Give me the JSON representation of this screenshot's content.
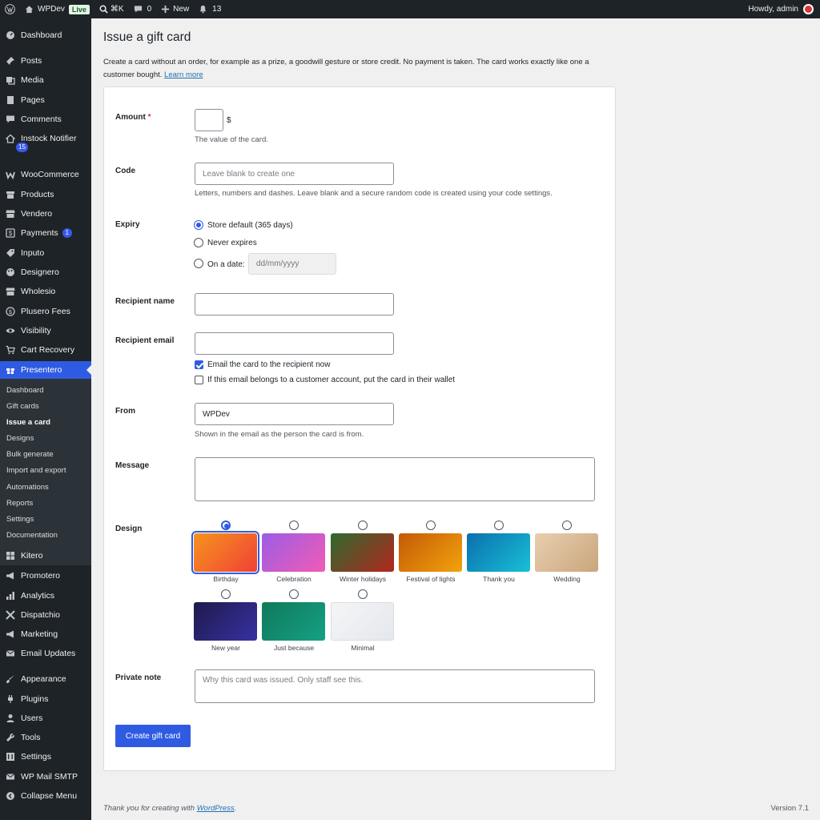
{
  "adminbar": {
    "site_name": "WPDev",
    "live_badge": "Live",
    "search_shortcut": "⌘K",
    "comments_count": "0",
    "new_label": "New",
    "notifications_count": "13",
    "greeting": "Howdy, admin"
  },
  "sidebar": {
    "items": [
      {
        "label": "Dashboard",
        "icon": "dashboard-icon"
      },
      {
        "label": "Posts",
        "icon": "pin-icon"
      },
      {
        "label": "Media",
        "icon": "media-icon"
      },
      {
        "label": "Pages",
        "icon": "pages-icon"
      },
      {
        "label": "Comments",
        "icon": "comment-icon"
      },
      {
        "label": "Instock Notifier",
        "icon": "bell-icon",
        "badge": "15"
      },
      {
        "label": "WooCommerce",
        "icon": "woo-icon"
      },
      {
        "label": "Products",
        "icon": "box-icon"
      },
      {
        "label": "Vendero",
        "icon": "store-icon"
      },
      {
        "label": "Payments",
        "icon": "dollar-icon",
        "badge": "1"
      },
      {
        "label": "Inputo",
        "icon": "tag-icon"
      },
      {
        "label": "Designero",
        "icon": "palette-icon"
      },
      {
        "label": "Wholesio",
        "icon": "store-icon"
      },
      {
        "label": "Plusero Fees",
        "icon": "coin-icon"
      },
      {
        "label": "Visibility",
        "icon": "eye-icon"
      },
      {
        "label": "Cart Recovery",
        "icon": "cart-icon"
      },
      {
        "label": "Presentero",
        "icon": "gift-icon"
      },
      {
        "label": "Kitero",
        "icon": "grid-icon"
      },
      {
        "label": "Promotero",
        "icon": "megaphone-icon"
      },
      {
        "label": "Analytics",
        "icon": "bar-chart-icon"
      },
      {
        "label": "Dispatchio",
        "icon": "plane-icon"
      },
      {
        "label": "Marketing",
        "icon": "megaphone-icon"
      },
      {
        "label": "Email Updates",
        "icon": "mail-icon"
      },
      {
        "label": "Appearance",
        "icon": "brush-icon"
      },
      {
        "label": "Plugins",
        "icon": "plug-icon"
      },
      {
        "label": "Users",
        "icon": "user-icon"
      },
      {
        "label": "Tools",
        "icon": "wrench-icon"
      },
      {
        "label": "Settings",
        "icon": "settings-icon"
      },
      {
        "label": "WP Mail SMTP",
        "icon": "mail-icon"
      },
      {
        "label": "Collapse Menu",
        "icon": "collapse-icon"
      }
    ],
    "submenu": [
      "Dashboard",
      "Gift cards",
      "Issue a card",
      "Designs",
      "Bulk generate",
      "Import and export",
      "Automations",
      "Reports",
      "Settings",
      "Documentation"
    ]
  },
  "page": {
    "title": "Issue a gift card",
    "intro": "Create a card without an order, for example as a prize, a goodwill gesture or store credit. No payment is taken. The card works exactly like one a customer bought.",
    "learn_more": "Learn more"
  },
  "form": {
    "amount": {
      "label": "Amount",
      "required_mark": "*",
      "currency": "$",
      "value": "",
      "help": "The value of the card."
    },
    "code": {
      "label": "Code",
      "placeholder": "Leave blank to create one",
      "help": "Letters, numbers and dashes. Leave blank and a secure random code is created using your code settings."
    },
    "expiry": {
      "label": "Expiry",
      "options": [
        "Store default (365 days)",
        "Never expires",
        "On a date:"
      ],
      "selected": "Store default (365 days)",
      "date_placeholder": "dd/mm/yyyy"
    },
    "recipient_name": {
      "label": "Recipient name",
      "value": ""
    },
    "recipient_email": {
      "label": "Recipient email",
      "value": "",
      "email_now": "Email the card to the recipient now",
      "email_now_checked": true,
      "wallet": "If this email belongs to a customer account, put the card in their wallet",
      "wallet_checked": false
    },
    "from": {
      "label": "From",
      "value": "WPDev",
      "help": "Shown in the email as the person the card is from."
    },
    "message": {
      "label": "Message",
      "value": ""
    },
    "design": {
      "label": "Design",
      "selected": "Birthday",
      "options": [
        {
          "name": "Birthday",
          "colors": [
            "#f7941d",
            "#ef4136"
          ]
        },
        {
          "name": "Celebration",
          "colors": [
            "#9b5de5",
            "#f15bb5"
          ]
        },
        {
          "name": "Winter holidays",
          "colors": [
            "#2d6a2e",
            "#b3261e"
          ]
        },
        {
          "name": "Festival of lights",
          "colors": [
            "#c45a06",
            "#f2a20c"
          ]
        },
        {
          "name": "Thank you",
          "colors": [
            "#0b6fae",
            "#19c0d6"
          ]
        },
        {
          "name": "Wedding",
          "colors": [
            "#e8cfb0",
            "#c9a57c"
          ]
        },
        {
          "name": "New year",
          "colors": [
            "#1e1b4b",
            "#3730a3"
          ]
        },
        {
          "name": "Just because",
          "colors": [
            "#0f7a5a",
            "#16a084"
          ]
        },
        {
          "name": "Minimal",
          "colors": [
            "#f4f5f7",
            "#e4e7ec"
          ]
        }
      ]
    },
    "private_note": {
      "label": "Private note",
      "placeholder": "Why this card was issued. Only staff see this."
    },
    "submit": "Create gift card"
  },
  "footer": {
    "thanks_prefix": "Thank you for creating with",
    "wordpress": "WordPress",
    "thanks_suffix": ".",
    "version": "Version 7.1"
  },
  "colors": {
    "accent": "#2f5be3",
    "sidebar_bg": "#1d2327",
    "link": "#2271b1"
  }
}
